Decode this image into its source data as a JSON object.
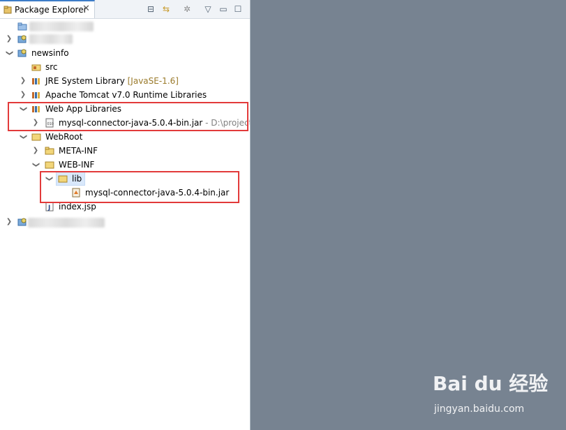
{
  "tab": {
    "title": "Package Explorer",
    "close": "✕"
  },
  "toolbar": {
    "collapse": "⊟",
    "link": "⇆",
    "gear": "✲",
    "menu": "▽",
    "minimize": "▭",
    "maximize": "☐"
  },
  "tree": {
    "newsinfo": "newsinfo",
    "src": "src",
    "jre": "JRE System Library",
    "jre_version": "[JavaSE-1.6]",
    "tomcat": "Apache Tomcat v7.0 Runtime Libraries",
    "webapp": "Web App Libraries",
    "mysql_jar": "mysql-connector-java-5.0.4-bin.jar",
    "mysql_jar_path": "- D:\\project",
    "webroot": "WebRoot",
    "metainf": "META-INF",
    "webinf": "WEB-INF",
    "lib": "lib",
    "lib_jar": "mysql-connector-java-5.0.4-bin.jar",
    "index": "index.jsp"
  },
  "watermark": {
    "brand": "Bai du 经验",
    "url": "jingyan.baidu.com"
  },
  "colors": {
    "accent": "#3d7dc8",
    "highlight": "#e23a3a",
    "editor_bg": "#778391"
  }
}
